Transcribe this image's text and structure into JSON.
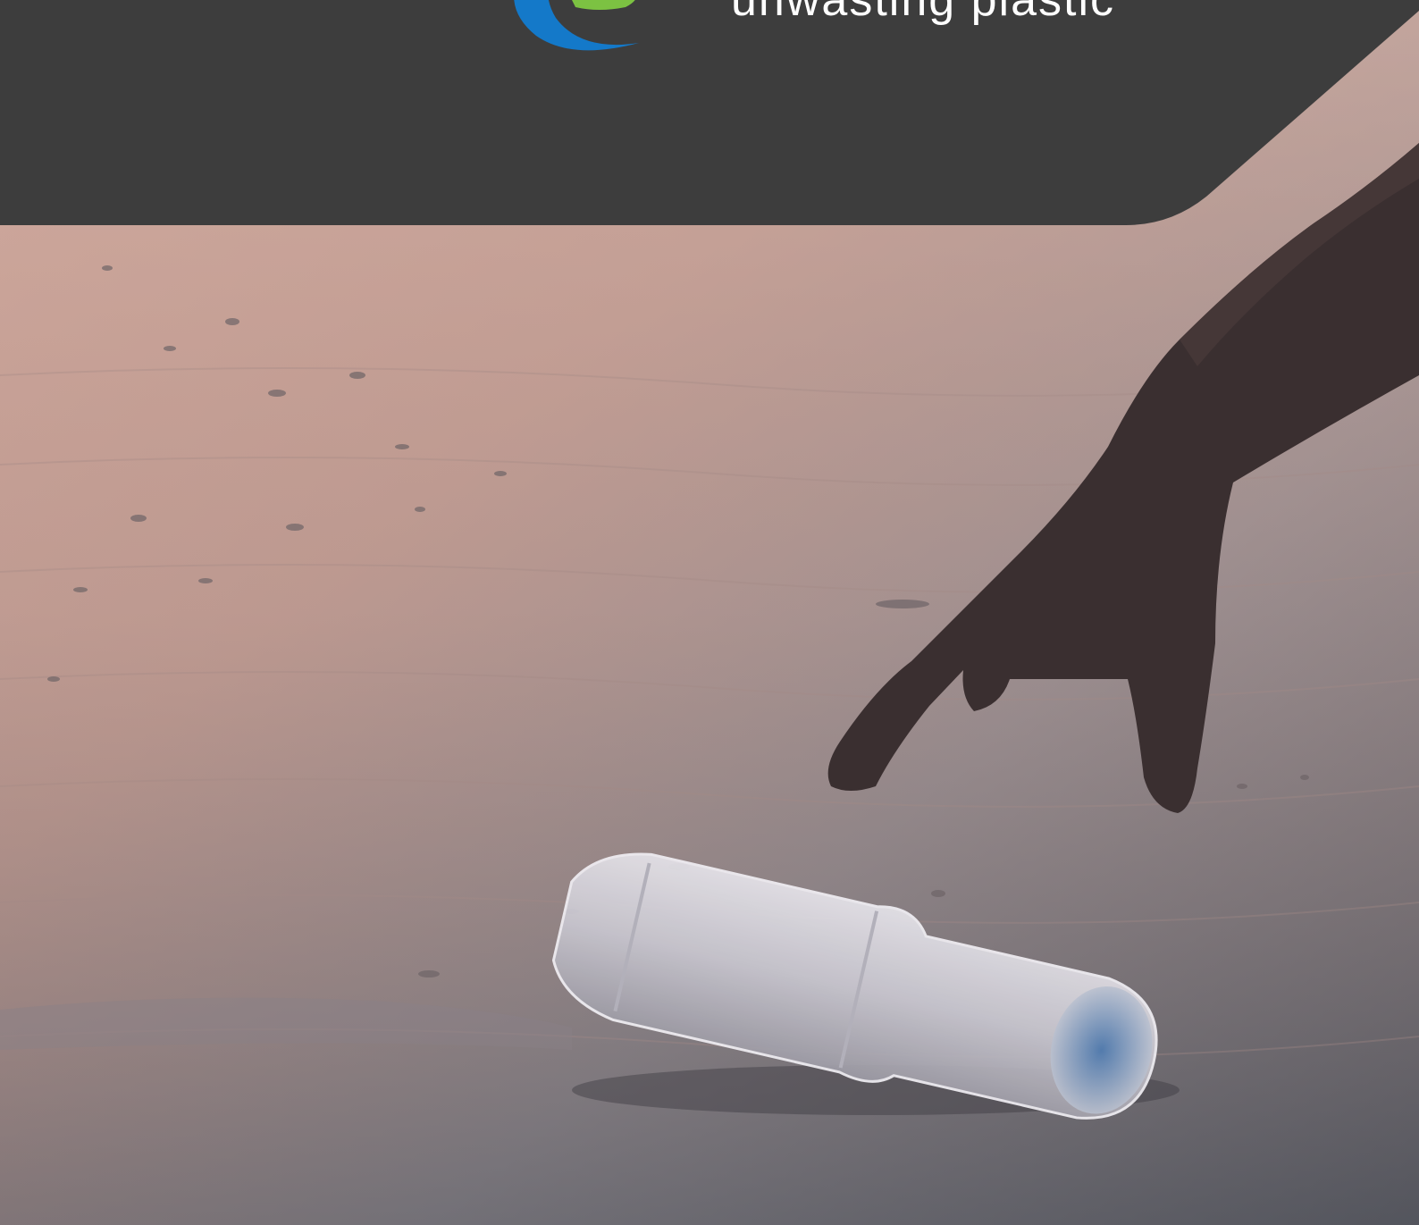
{
  "brand": {
    "tagline": "unwasting plastic",
    "colors": {
      "band": "#3d3d3d",
      "logo_blue": "#1479c9",
      "logo_green": "#7cc242",
      "text": "#ffffff"
    }
  },
  "photo": {
    "icons": [
      "hand-reaching",
      "plastic-bottle",
      "beach-sand"
    ]
  }
}
